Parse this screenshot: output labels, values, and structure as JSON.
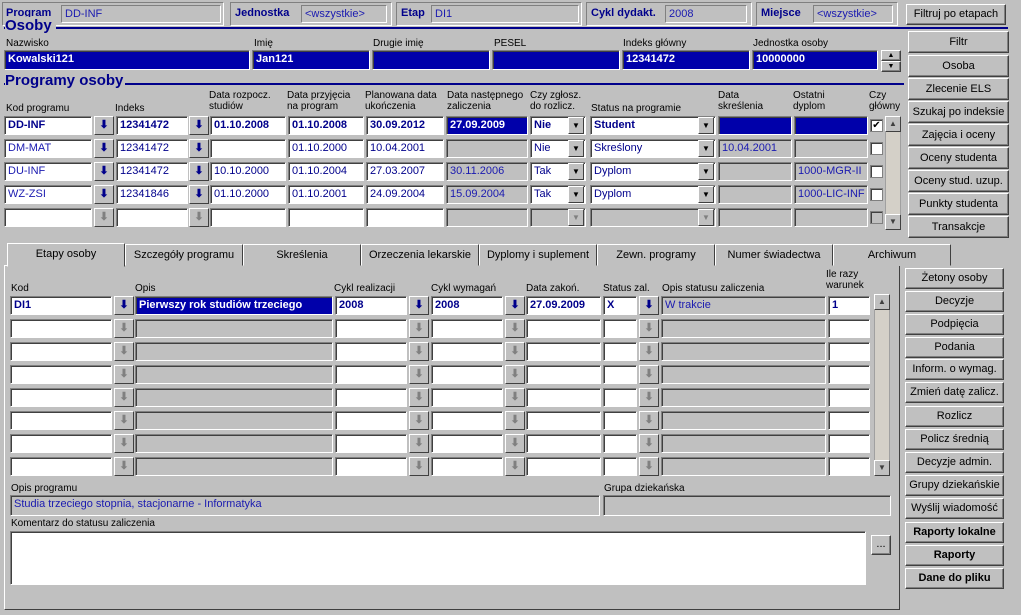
{
  "top": {
    "program_label": "Program",
    "program_value": "DD-INF",
    "jednostka_label": "Jednostka",
    "jednostka_value": "<wszystkie>",
    "etap_label": "Etap",
    "etap_value": "DI1",
    "cykl_label": "Cykl dydakt.",
    "cykl_value": "2008",
    "miejsce_label": "Miejsce",
    "miejsce_value": "<wszystkie>",
    "filter_button": "Filtruj po etapach"
  },
  "osoby": {
    "title": "Osoby",
    "nazwisko_label": "Nazwisko",
    "nazwisko": "Kowalski121",
    "imie_label": "Imię",
    "imie": "Jan121",
    "drugie_label": "Drugie imię",
    "drugie": "",
    "pesel_label": "PESEL",
    "pesel": "",
    "indeks_label": "Indeks główny",
    "indeks": "12341472",
    "jednostka_label": "Jednostka osoby",
    "jednostka": "10000000"
  },
  "programy": {
    "title": "Programy osoby",
    "headers": {
      "kod": "Kod programu",
      "indeks": "Indeks",
      "data_rozp": "Data rozpocz. studiów",
      "data_przyj": "Data przyjęcia na program",
      "plan": "Planowana data ukończenia",
      "nast": "Data następnego zaliczenia",
      "zglosz": "Czy zgłosz. do rozlicz.",
      "status": "Status na programie",
      "skresl": "Data skreślenia",
      "dyplom": "Ostatni dyplom",
      "glowny": "Czy główny"
    },
    "rows": [
      {
        "kod": "DD-INF",
        "indeks": "12341472",
        "rozp": "01.10.2008",
        "przyj": "01.10.2008",
        "plan": "30.09.2012",
        "nast": "27.09.2009",
        "zgl": "Nie",
        "status": "Student",
        "skresl": "",
        "dyplom": "",
        "glowny": "✔"
      },
      {
        "kod": "DM-MAT",
        "indeks": "12341472",
        "rozp": "",
        "przyj": "01.10.2000",
        "plan": "10.04.2001",
        "nast": "",
        "zgl": "Nie",
        "status": "Skreślony",
        "skresl": "10.04.2001",
        "dyplom": "",
        "glowny": ""
      },
      {
        "kod": "DU-INF",
        "indeks": "12341472",
        "rozp": "10.10.2000",
        "przyj": "01.10.2004",
        "plan": "27.03.2007",
        "nast": "30.11.2006",
        "zgl": "Tak",
        "status": "Dyplom",
        "skresl": "",
        "dyplom": "1000-MGR-II",
        "glowny": ""
      },
      {
        "kod": "WZ-ZSI",
        "indeks": "12341846",
        "rozp": "01.10.2000",
        "przyj": "01.10.2001",
        "plan": "24.09.2004",
        "nast": "15.09.2004",
        "zgl": "Tak",
        "status": "Dyplom",
        "skresl": "",
        "dyplom": "1000-LIC-INF",
        "glowny": ""
      },
      {
        "kod": "",
        "indeks": "",
        "rozp": "",
        "przyj": "",
        "plan": "",
        "nast": "",
        "zgl": "",
        "status": "",
        "skresl": "",
        "dyplom": "",
        "glowny": ""
      }
    ]
  },
  "right_buttons": [
    "Filtr",
    "Osoba",
    "Zlecenie ELS",
    "Szukaj po indeksie",
    "Zajęcia i oceny",
    "Oceny studenta",
    "Oceny stud. uzup.",
    "Punkty studenta",
    "Transakcje"
  ],
  "tabs": [
    "Etapy osoby",
    "Szczegóły programu",
    "Skreślenia",
    "Orzeczenia lekarskie",
    "Dyplomy i suplement",
    "Zewn. programy",
    "Numer świadectwa",
    "Archiwum"
  ],
  "etapy": {
    "headers": {
      "kod": "Kod",
      "opis": "Opis",
      "cykl_real": "Cykl realizacji",
      "cykl_wym": "Cykl wymagań",
      "data_zak": "Data zakoń.",
      "status": "Status zal.",
      "opis_status": "Opis statusu zaliczenia",
      "ile": "Ile razy warunek"
    },
    "rows": [
      {
        "kod": "DI1",
        "opis": "Pierwszy rok studiów trzeciego",
        "real": "2008",
        "wym": "2008",
        "data": "27.09.2009",
        "status": "X",
        "opis_status": "W trakcie",
        "ile": "1"
      }
    ]
  },
  "bottom": {
    "opis_programu_label": "Opis programu",
    "opis_programu": "Studia trzeciego stopnia, stacjonarne - Informatyka",
    "grupa_label": "Grupa dziekańska",
    "grupa": "",
    "komentarz_label": "Komentarz do statusu zaliczenia",
    "komentarz": "",
    "more": "..."
  },
  "lower_buttons": [
    "Żetony osoby",
    "Decyzje",
    "Podpięcia",
    "Podania",
    "Inform. o wymag.",
    "Zmień datę zalicz.",
    "Rozlicz",
    "Policz średnią",
    "Decyzje admin.",
    "Grupy dziekańskie",
    "Wyślij wiadomość",
    "Raporty lokalne",
    "Raporty",
    "Dane do pliku"
  ]
}
